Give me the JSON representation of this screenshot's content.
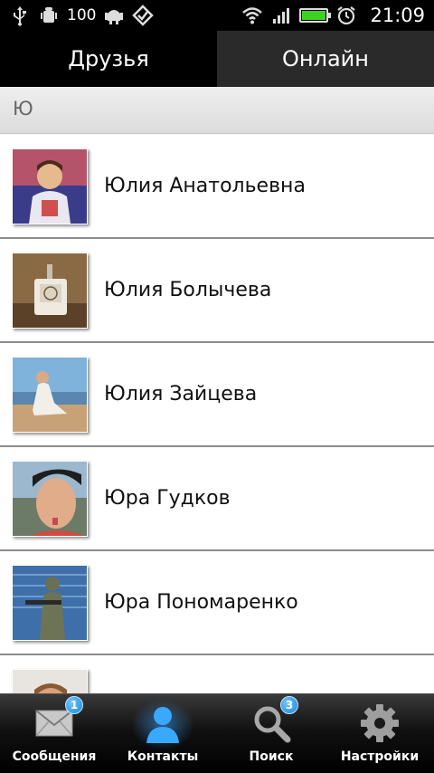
{
  "status_bar": {
    "battery_percent": "100",
    "time": "21:09",
    "battery_level": 1.0,
    "accent": "#3fd120"
  },
  "tabs": [
    {
      "label": "Друзья",
      "active": true
    },
    {
      "label": "Онлайн",
      "active": false
    }
  ],
  "section": {
    "letter": "Ю"
  },
  "contacts": [
    {
      "name": "Юлия Анатольевна"
    },
    {
      "name": "Юлия Болычева"
    },
    {
      "name": "Юлия Зайцева"
    },
    {
      "name": "Юра Гудков"
    },
    {
      "name": "Юра Пономаренко"
    },
    {
      "name": ""
    }
  ],
  "bottom_nav": [
    {
      "label": "Сообщения",
      "icon": "envelope-icon",
      "badge": "1"
    },
    {
      "label": "Контакты",
      "icon": "person-icon",
      "active": true
    },
    {
      "label": "Поиск",
      "icon": "magnifier-icon",
      "badge": "3"
    },
    {
      "label": "Настройки",
      "icon": "gear-icon"
    }
  ],
  "colors": {
    "badge_blue": "#1b86d6",
    "active_glow": "#3ca0ff"
  }
}
